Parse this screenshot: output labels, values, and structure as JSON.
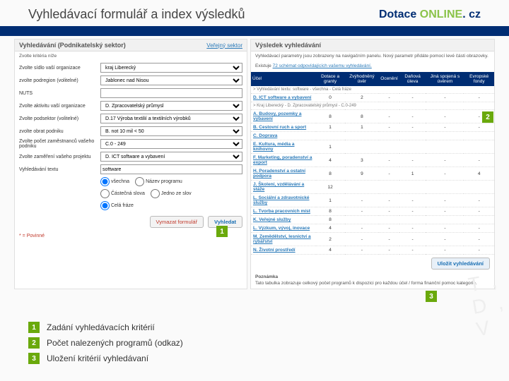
{
  "header": {
    "title": "Vyhledávací formulář a index výsledků",
    "brand_1": "Dotace ",
    "brand_2": "ONLINE",
    "brand_3": ". cz"
  },
  "left": {
    "title": "Vyhledávání (Podnikatelský sektor)",
    "alt_link": "Veřejný sektor",
    "subtitle": "Zvolte kritéria níže",
    "rows": {
      "sidlo": {
        "label": "Zvolte sídlo vaší organizace",
        "value": "kraj Liberecký"
      },
      "podregion": {
        "label": "zvolte podregion (volitelné)",
        "value": "Jablonec nad Nisou"
      },
      "nuts": {
        "label": "NUTS",
        "value": ""
      },
      "aktivita": {
        "label": "Zvolte aktivitu vaší organizace",
        "value": "D. Zpracovatelský průmysl"
      },
      "podsektor": {
        "label": "Zvolte podsektor (volitelné)",
        "value": "D.17 Výroba textilií a textilních výrobků"
      },
      "obrat": {
        "label": "zvolte obrat podniku",
        "value": "B. not 10 mil < 50"
      },
      "zamestnanci": {
        "label": "Zvolte počet zaměstnanců vašeho podniku",
        "value": "C.0 - 249"
      },
      "zamereni": {
        "label": "Zvolte zaměření vašeho projektu",
        "value": "D. ICT software a vybavení"
      },
      "text": {
        "label": "Vyhledávání textu",
        "value": "software"
      }
    },
    "radio_group1": {
      "opt_vsechna": "všechna",
      "opt_nazev": "Název programu"
    },
    "radio_group2": {
      "opt_cast": "Částečná slova",
      "opt_jedno": "Jedno ze slov",
      "opt_fraze": "Celá fráze"
    },
    "required": "* = Povinné",
    "btn_clear": "Vymazat formulář",
    "btn_search": "Vyhledat"
  },
  "right": {
    "title": "Výsledek vyhledávání",
    "subtitle": "Vyhledávací parametry jsou zobrazeny na navigačním panelu. Nový parametr přidáte pomocí levé části obrazovky.",
    "schema_pre": "Existuje ",
    "schema_link": "72 schémat odpovídajících vašemu vyhledávání.",
    "cols": [
      "Účel",
      "Dotace a granty",
      "Zvýhodněný úvěr",
      "Ocenění",
      "Daňová úleva",
      "Jiná spojená s úvěrem",
      "Evropské fondy"
    ],
    "groups": [
      {
        "heading": "> Vyhledávání textu: software - všechna - Celá fráze",
        "rows": [
          {
            "cat": "D. ICT software a vybavení",
            "v": [
              "0",
              "2",
              "-",
              "-",
              "-",
              "-"
            ]
          }
        ]
      },
      {
        "heading": "> Kraj Liberecký - D. Zpracovatelský průmysl - C.0-249",
        "rows": [
          {
            "cat": "A. Budovy, pozemky a vybavení",
            "v": [
              "8",
              "8",
              "-",
              "-",
              "-",
              "-"
            ]
          },
          {
            "cat": "B. Cestovní ruch a sport",
            "v": [
              "1",
              "1",
              "-",
              "-",
              "-",
              "-"
            ]
          },
          {
            "cat": "C. Doprava",
            "v": [
              "",
              "",
              "",
              "",
              "",
              ""
            ]
          },
          {
            "cat": "E. Kultura, média a knihovny",
            "v": [
              "1",
              "",
              "",
              "",
              "",
              ""
            ]
          },
          {
            "cat": "F. Marketing, poradenství a export",
            "v": [
              "4",
              "3",
              "-",
              "-",
              "-",
              "-"
            ]
          },
          {
            "cat": "H. Poradenství a ostatní podpora",
            "v": [
              "8",
              "9",
              "-",
              "1",
              "-",
              "4"
            ]
          },
          {
            "cat": "J. Školení, vzdělávání a stáže",
            "v": [
              "12",
              "",
              "",
              "",
              "",
              ""
            ]
          },
          {
            "cat": "L. Sociální a zdravotnické služby",
            "v": [
              "1",
              "-",
              "-",
              "-",
              "-",
              "-"
            ]
          },
          {
            "cat": "L. Tvorba pracovních míst",
            "v": [
              "8",
              "-",
              "-",
              "-",
              "-",
              "-"
            ]
          },
          {
            "cat": "K. Veřejné služby",
            "v": [
              "8",
              "",
              "",
              "",
              "",
              ""
            ]
          },
          {
            "cat": "L. Výzkum, vývoj, inovace",
            "v": [
              "4",
              "-",
              "-",
              "-",
              "-",
              "-"
            ]
          },
          {
            "cat": "M. Zemědělství, lesnictví a rybářství",
            "v": [
              "2",
              "-",
              "-",
              "-",
              "-",
              "-"
            ]
          },
          {
            "cat": "N. Životní prostředí",
            "v": [
              "4",
              "-",
              "-",
              "-",
              "-",
              "-"
            ]
          }
        ]
      }
    ],
    "btn_save": "Uložit vyhledávání",
    "notes_title": "Poznámka",
    "notes": "Tato tabulka zobrazuje celkový počet programů k dispozici pro každou účel / forma finanční pomoc kategorie."
  },
  "legend": {
    "l1": "Zadání vyhledávacích kritérií",
    "l2": "Počet nalezených programů (odkaz)",
    "l3": "Uložení kritérií vyhledávaní"
  }
}
